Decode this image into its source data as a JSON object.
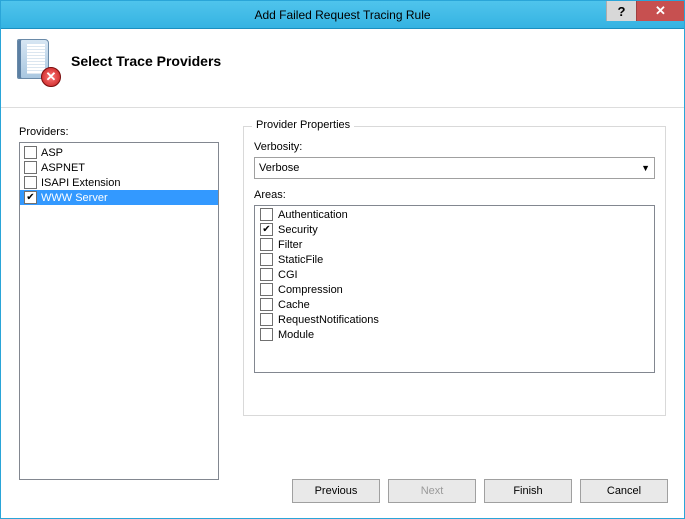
{
  "window": {
    "title": "Add Failed Request Tracing Rule",
    "help_symbol": "?",
    "close_symbol": "✕"
  },
  "header": {
    "heading": "Select Trace Providers",
    "badge_symbol": "✕"
  },
  "providers": {
    "label": "Providers:",
    "items": [
      {
        "label": "ASP",
        "checked": false,
        "selected": false
      },
      {
        "label": "ASPNET",
        "checked": false,
        "selected": false
      },
      {
        "label": "ISAPI Extension",
        "checked": false,
        "selected": false
      },
      {
        "label": "WWW Server",
        "checked": true,
        "selected": true
      }
    ]
  },
  "properties": {
    "title": "Provider Properties",
    "verbosity_label": "Verbosity:",
    "verbosity_value": "Verbose",
    "areas_label": "Areas:",
    "areas": [
      {
        "label": "Authentication",
        "checked": false
      },
      {
        "label": "Security",
        "checked": true
      },
      {
        "label": "Filter",
        "checked": false
      },
      {
        "label": "StaticFile",
        "checked": false
      },
      {
        "label": "CGI",
        "checked": false
      },
      {
        "label": "Compression",
        "checked": false
      },
      {
        "label": "Cache",
        "checked": false
      },
      {
        "label": "RequestNotifications",
        "checked": false
      },
      {
        "label": "Module",
        "checked": false
      }
    ]
  },
  "footer": {
    "previous": "Previous",
    "next": "Next",
    "finish": "Finish",
    "cancel": "Cancel"
  }
}
